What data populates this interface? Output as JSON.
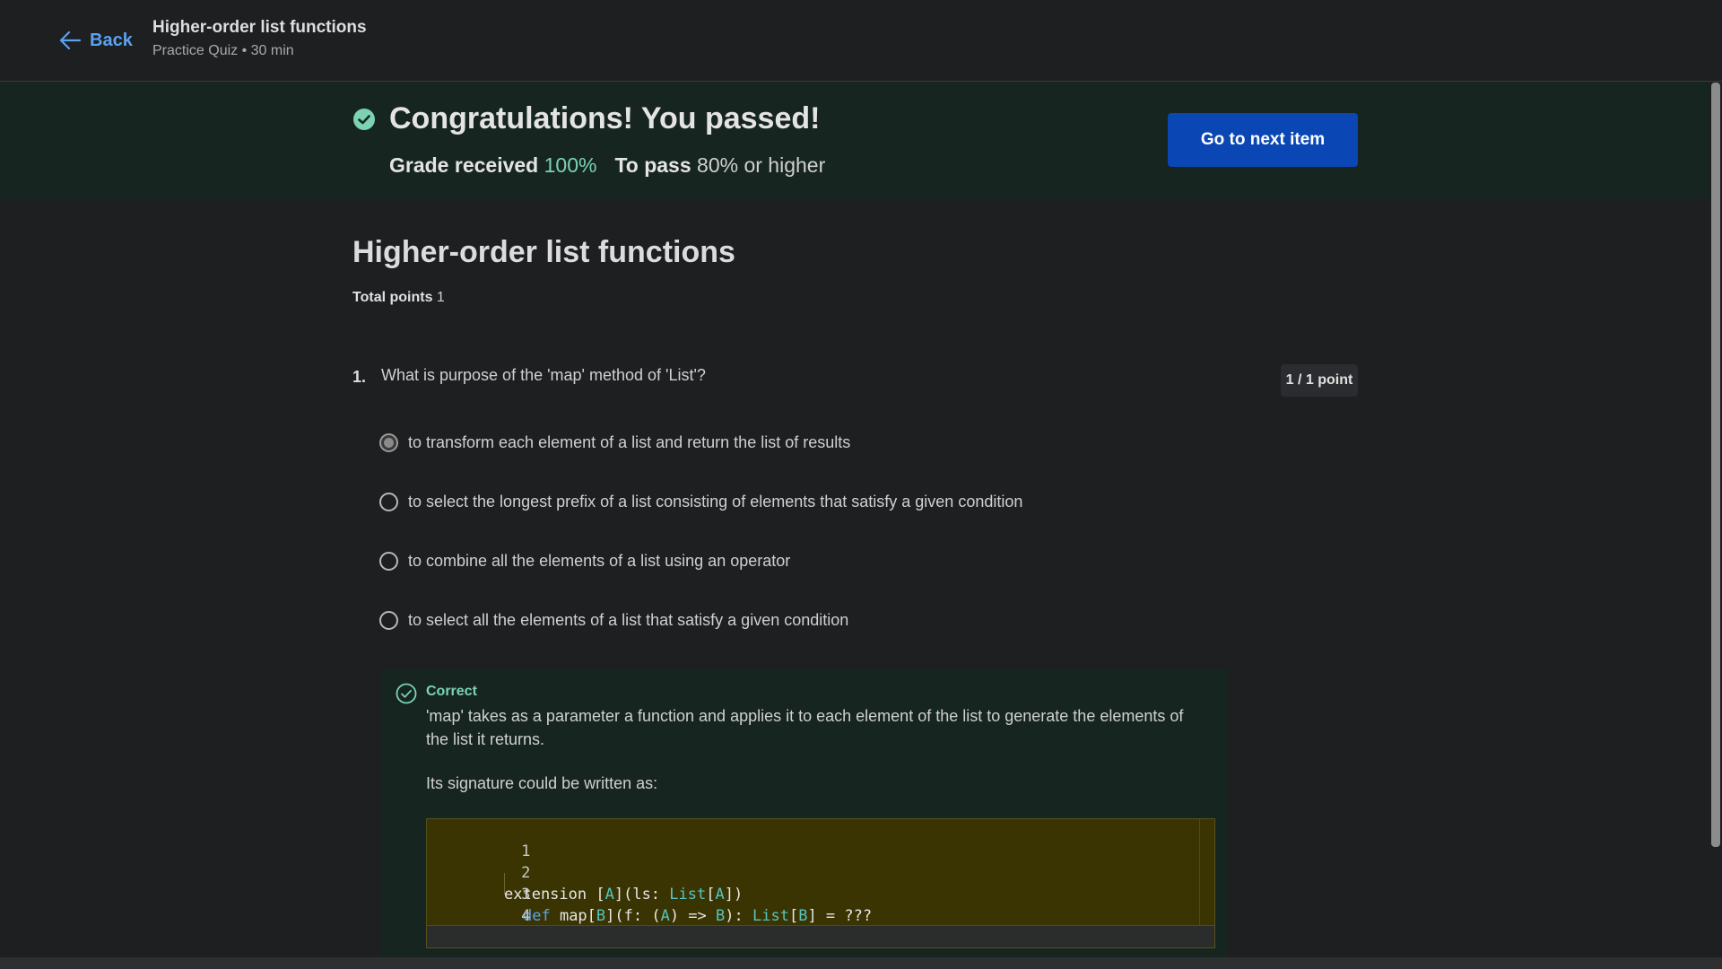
{
  "header": {
    "back_label": "Back",
    "title": "Higher-order list functions",
    "subtitle": "Practice Quiz • 30 min"
  },
  "banner": {
    "title": "Congratulations! You passed!",
    "grade_label": "Grade received",
    "grade_value": "100%",
    "pass_label": "To pass",
    "pass_value": "80% or higher",
    "next_button": "Go to next item"
  },
  "quiz": {
    "title": "Higher-order list functions",
    "total_points_label": "Total points",
    "total_points_value": "1"
  },
  "question": {
    "number": "1.",
    "text": "What is purpose of the 'map' method of 'List'?",
    "points": "1 / 1 point",
    "options": [
      {
        "label": "to transform each element of a list and return the list of results",
        "selected": true
      },
      {
        "label": "to select the longest prefix of a list consisting of elements that satisfy a given condition",
        "selected": false
      },
      {
        "label": "to combine all the elements of a list using an operator",
        "selected": false
      },
      {
        "label": "to select all the elements of a list that satisfy a given condition",
        "selected": false
      }
    ]
  },
  "feedback": {
    "status": "Correct",
    "explanation": "'map' takes as a parameter a function and applies it to each element of the list to generate the elements of the list it returns.",
    "signature_intro": "Its signature could be written as:",
    "code_lines": [
      "1",
      "2",
      "3",
      "4"
    ],
    "code_line2_parts": [
      "extension ",
      "[",
      "A",
      "](ls: ",
      "List",
      "[",
      "A",
      "])"
    ],
    "code_line3_parts": [
      "def",
      " map[",
      "B",
      "](f: (",
      "A",
      ") => ",
      "B",
      "): ",
      "List",
      "[",
      "B",
      "] = ???"
    ]
  },
  "colors": {
    "accent": "#0a47b5",
    "success": "#7bd3b4",
    "link": "#5aa2f2"
  }
}
